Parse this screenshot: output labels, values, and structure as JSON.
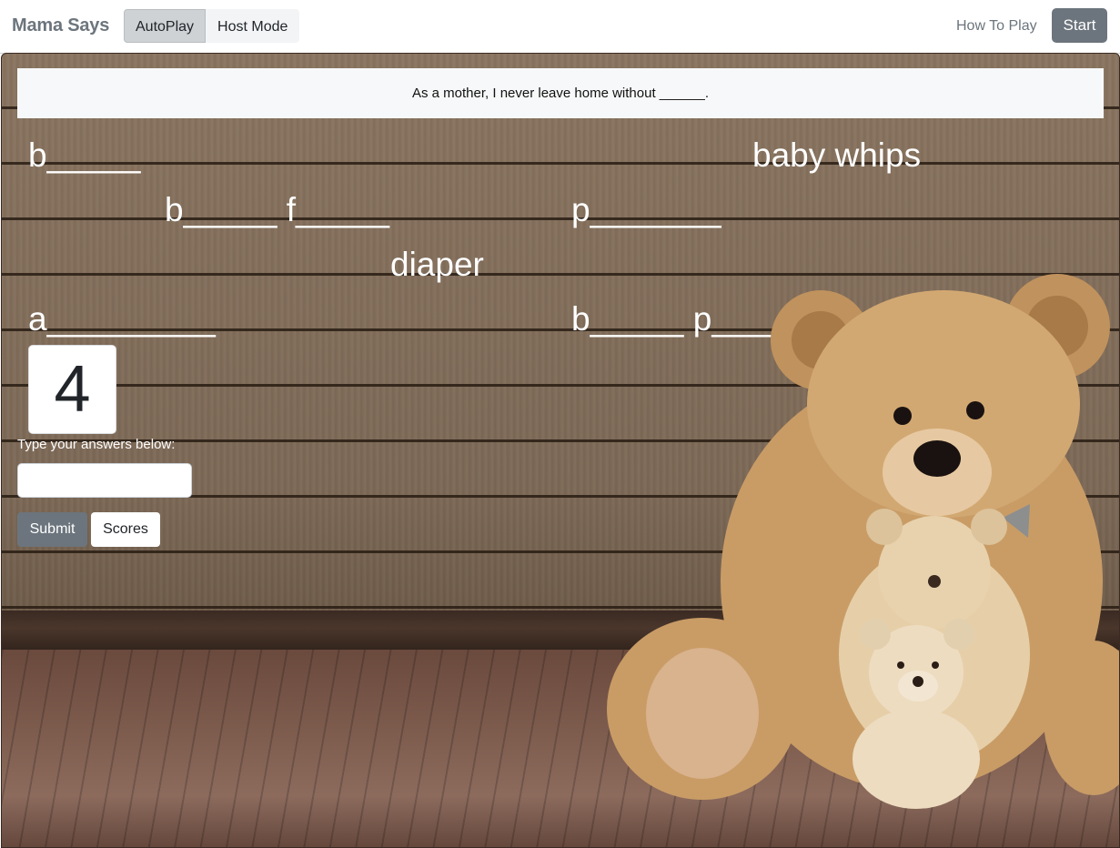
{
  "navbar": {
    "brand": "Mama Says",
    "modes": [
      "AutoPlay",
      "Host Mode"
    ],
    "active_mode": "AutoPlay",
    "how_to_play": "How To Play",
    "start": "Start"
  },
  "game": {
    "question": "As a mother, I never leave home without ______.",
    "answers": [
      {
        "text": "b_____"
      },
      {
        "text": "baby whips"
      },
      {
        "text": "b_____ f_____"
      },
      {
        "text": "p_______"
      },
      {
        "text": "diaper"
      },
      {
        "text": "a_________"
      },
      {
        "text": "b_____ p____"
      }
    ],
    "timer": "4",
    "input_label": "Type your answers below:",
    "input_value": "",
    "input_placeholder": "",
    "submit": "Submit",
    "scores": "Scores"
  },
  "colors": {
    "nav_bg": "#ffffff",
    "secondary": "#6c757d",
    "answer_text": "#ffffff"
  },
  "icons": {
    "illustration": "teddy-bear-family"
  }
}
